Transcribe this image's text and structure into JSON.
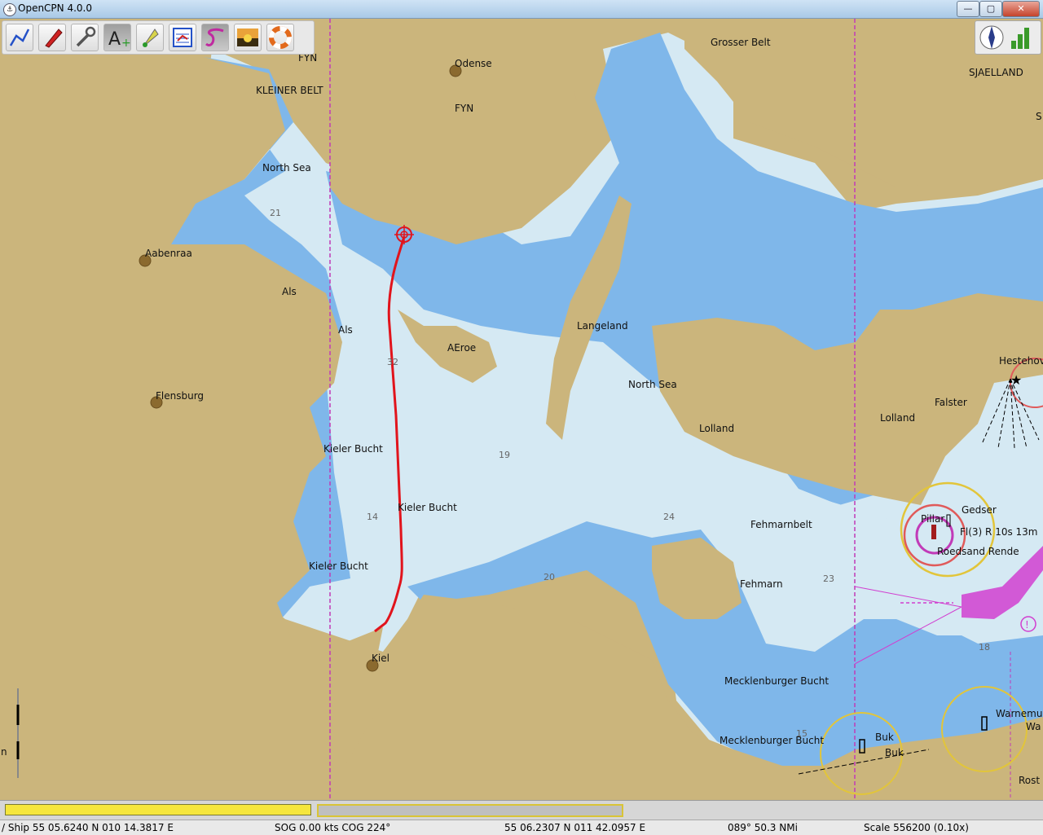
{
  "window": {
    "title": "OpenCPN 4.0.0",
    "minimize": "—",
    "maximize": "▢",
    "close": "✕"
  },
  "toolbar": {
    "tools": [
      {
        "name": "route-tool",
        "icon": "route-icon"
      },
      {
        "name": "ship-tool",
        "icon": "ship-icon"
      },
      {
        "name": "settings-tool",
        "icon": "wrench-icon"
      },
      {
        "name": "text-tool",
        "icon": "text-a-icon"
      },
      {
        "name": "mark-tool",
        "icon": "mark-flag-icon"
      },
      {
        "name": "route-manager-tool",
        "icon": "route-manager-icon"
      },
      {
        "name": "track-tool",
        "icon": "track-icon"
      },
      {
        "name": "color-scheme-tool",
        "icon": "sunset-icon"
      },
      {
        "name": "mob-tool",
        "icon": "lifebuoy-icon"
      }
    ]
  },
  "map": {
    "labels": {
      "fyn_top": "FYN",
      "odense": "Odense",
      "grosser_belt": "Grosser Belt",
      "sjaelland": "SJAELLAND",
      "kleiner_belt": "KLEINER BELT",
      "fyn": "FYN",
      "north_sea_1": "North Sea",
      "aabenraa": "Aabenraa",
      "als_1": "Als",
      "als_2": "Als",
      "aeroe": "AEroe",
      "langeland": "Langeland",
      "north_sea_2": "North Sea",
      "hestehoved": "Hestehov",
      "falster": "Falster",
      "lolland_1": "Lolland",
      "lolland_2": "Lolland",
      "flensburg": "Flensburg",
      "kieler_bucht_1": "Kieler Bucht",
      "kieler_bucht_2": "Kieler Bucht",
      "kieler_bucht_3": "Kieler Bucht",
      "fehmarnbelt": "Fehmarnbelt",
      "gedser": "Gedser",
      "pillar": "Pillar",
      "light_char": "Fl(3) R 10s 13m",
      "roedsand": "Roedsand Rende",
      "fehmarn": "Fehmarn",
      "kiel": "Kiel",
      "mecklenburger_bucht_1": "Mecklenburger Bucht",
      "mecklenburger_bucht_2": "Mecklenburger Bucht",
      "buk_1": "Buk",
      "buk_2": "Buk",
      "warnemunde": "Warnemu",
      "wa": "Wa",
      "rostock": "Rost",
      "s_edge": "S",
      "n_edge": "n"
    },
    "depths": {
      "d21": "21",
      "d32": "32",
      "d19": "19",
      "d14": "14",
      "d24": "24",
      "d20": "20",
      "d23": "23",
      "d18": "18",
      "d15": "15"
    },
    "colors": {
      "land": "#cbb57c",
      "shallow": "#7fb7ea",
      "deep": "#d5e9f3",
      "route": "#e1141c",
      "boundary": "#c13bb8",
      "traffic": "#d13fd0",
      "light_ring": "#e2c53a"
    }
  },
  "status": {
    "ship": "/ Ship 55 05.6240 N   010 14.3817 E",
    "sog_cog": "SOG 0.00 kts  COG 224°",
    "cursor": "55 06.2307 N   011 42.0957 E",
    "bearing_dist": "089°  50.3 NMi",
    "scale": "Scale 556200 (0.10x)"
  }
}
